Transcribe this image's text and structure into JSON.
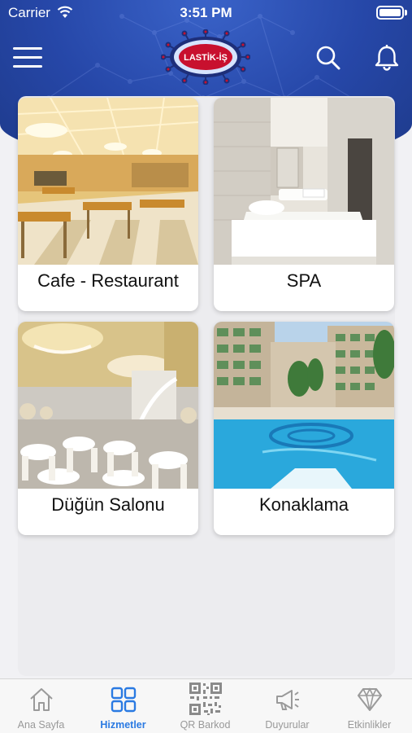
{
  "status_bar": {
    "carrier": "Carrier",
    "time": "3:51 PM"
  },
  "header": {
    "logo_text": "LASTİK-İŞ",
    "menu_icon": "hamburger-icon",
    "search_icon": "search-icon",
    "notification_icon": "bell-icon",
    "color_primary": "#2647a8"
  },
  "services": [
    {
      "label": "Cafe - Restaurant",
      "icon": "restaurant-photo"
    },
    {
      "label": "SPA",
      "icon": "spa-photo"
    },
    {
      "label": "Düğün Salonu",
      "icon": "wedding-hall-photo"
    },
    {
      "label": "Konaklama",
      "icon": "hotel-pool-photo"
    }
  ],
  "tabbar": {
    "active_color": "#2a7ae2",
    "tabs": [
      {
        "label": "Ana Sayfa",
        "icon": "home-icon",
        "active": false
      },
      {
        "label": "Hizmetler",
        "icon": "grid-icon",
        "active": true
      },
      {
        "label": "QR Barkod",
        "icon": "qr-code-icon",
        "active": false
      },
      {
        "label": "Duyurular",
        "icon": "megaphone-icon",
        "active": false
      },
      {
        "label": "Etkinlikler",
        "icon": "diamond-icon",
        "active": false
      }
    ]
  }
}
